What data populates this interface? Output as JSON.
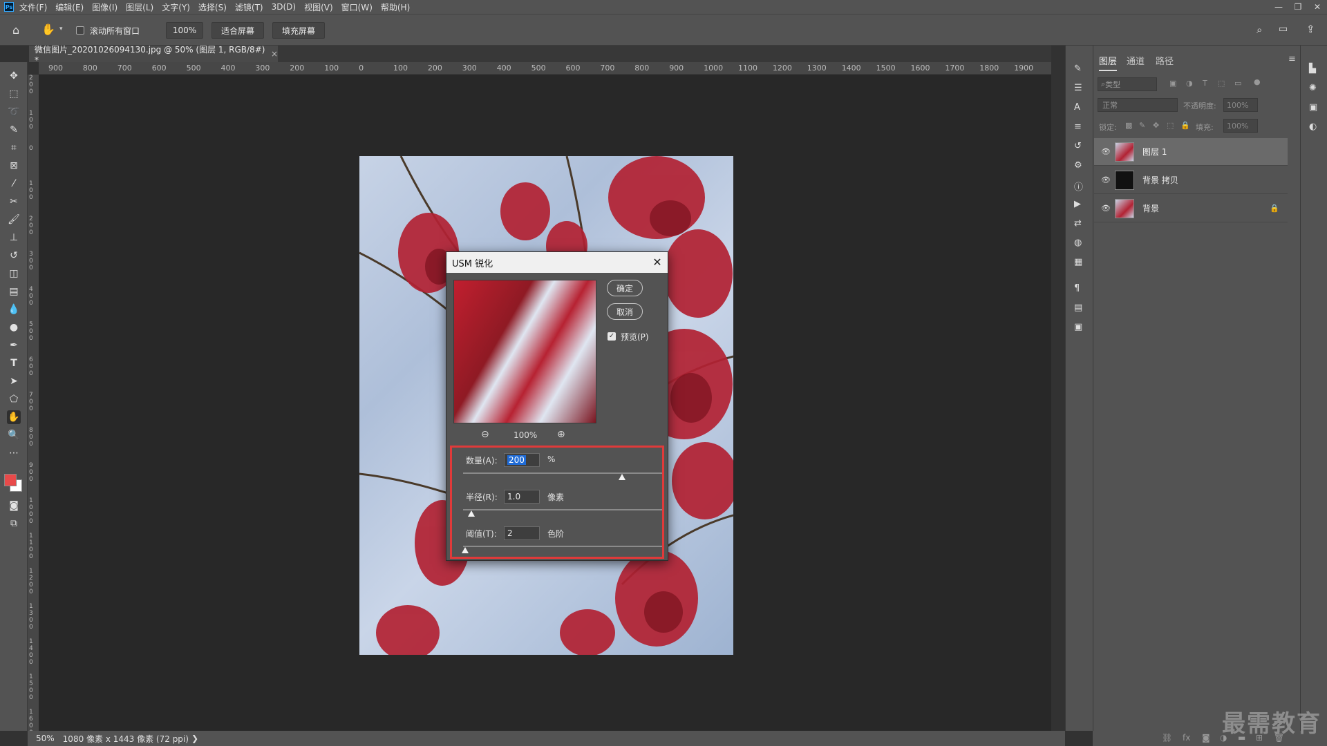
{
  "menubar": {
    "app_icon": "Ps",
    "items": [
      "文件(F)",
      "编辑(E)",
      "图像(I)",
      "图层(L)",
      "文字(Y)",
      "选择(S)",
      "滤镜(T)",
      "3D(D)",
      "视图(V)",
      "窗口(W)",
      "帮助(H)"
    ],
    "window_controls": [
      "—",
      "❐",
      "✕"
    ]
  },
  "optbar": {
    "scroll_all_label": "滚动所有窗口",
    "zoom_value": "100%",
    "fit_screen_label": "适合屏幕",
    "fill_screen_label": "填充屏幕"
  },
  "document": {
    "tab_title": "微信图片_20201026094130.jpg @ 50% (图层 1, RGB/8#) *",
    "tab_close": "×"
  },
  "ruler": {
    "h_ticks": [
      "900",
      "800",
      "700",
      "600",
      "500",
      "400",
      "300",
      "200",
      "100",
      "0",
      "100",
      "200",
      "300",
      "400",
      "500",
      "600",
      "700",
      "800",
      "900",
      "1000",
      "1100",
      "1200",
      "1300",
      "1400",
      "1500",
      "1600",
      "1700",
      "1800",
      "1900"
    ],
    "v_ticks": [
      "2 0 0",
      "1 0 0",
      "0",
      "1 0 0",
      "2 0 0",
      "3 0 0",
      "4 0 0",
      "5 0 0",
      "6 0 0",
      "7 0 0",
      "8 0 0",
      "9 0 0",
      "1 0 0 0",
      "1 1 0 0",
      "1 2 0 0",
      "1 3 0 0",
      "1 4 0 0",
      "1 5 0 0",
      "1 6 0 0"
    ]
  },
  "dialog": {
    "title": "USM 锐化",
    "close": "✕",
    "ok_label": "确定",
    "cancel_label": "取消",
    "preview_label": "预览(P)",
    "preview_checked": true,
    "preview_zoom": "100%",
    "amount_label": "数量(A):",
    "amount_value": "200",
    "amount_unit": "%",
    "amount_slider_fraction": 0.8,
    "radius_label": "半径(R):",
    "radius_value": "1.0",
    "radius_unit": "像素",
    "radius_slider_fraction": 0.04,
    "threshold_label": "阈值(T):",
    "threshold_value": "2",
    "threshold_unit": "色阶",
    "threshold_slider_fraction": 0.01
  },
  "layers_panel": {
    "tabs": [
      "图层",
      "通道",
      "路径"
    ],
    "filter_placeholder": "类型",
    "blend_mode": "正常",
    "opacity_label": "不透明度:",
    "opacity_value": "100%",
    "lock_label": "锁定:",
    "fill_label": "填充:",
    "fill_value": "100%",
    "layers": [
      {
        "name": "图层 1",
        "selected": true,
        "locked": false
      },
      {
        "name": "背景 拷贝",
        "selected": false,
        "locked": false
      },
      {
        "name": "背景",
        "selected": false,
        "locked": true
      }
    ]
  },
  "status": {
    "zoom": "50%",
    "info": "1080 像素 x 1443 像素 (72 ppi)",
    "arrow": "❯"
  },
  "watermark": "最需教育",
  "colors": {
    "foreground": "#e84a4a",
    "background": "#ffffff",
    "highlight_box": "#e03a3a"
  }
}
